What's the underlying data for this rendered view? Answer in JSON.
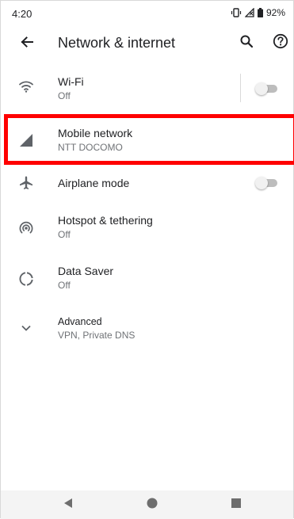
{
  "status_bar": {
    "time": "4:20",
    "battery": "92%"
  },
  "app_bar": {
    "title": "Network & internet",
    "icons": {
      "back": "arrow-back-icon",
      "search": "search-icon",
      "help": "help-icon"
    }
  },
  "settings": {
    "items": [
      {
        "title": "Wi-Fi",
        "summary": "Off",
        "icon": "wifi-icon",
        "toggle": "off"
      },
      {
        "title": "Mobile network",
        "summary": "NTT DOCOMO",
        "icon": "cell-signal-icon"
      },
      {
        "title": "Airplane mode",
        "icon": "airplane-icon",
        "toggle": "off"
      },
      {
        "title": "Hotspot & tethering",
        "summary": "Off",
        "icon": "hotspot-icon"
      },
      {
        "title": "Data Saver",
        "summary": "Off",
        "icon": "data-saver-icon"
      },
      {
        "title": "Advanced",
        "summary": "VPN, Private DNS",
        "icon": "chevron-down-icon"
      }
    ]
  },
  "highlight": {
    "target": "Mobile network",
    "color": "#ff0000"
  },
  "colors": {
    "text_primary": "#202124",
    "text_secondary": "#6f7276",
    "icon": "#5f6368",
    "toggle_track": "#bdbdbd",
    "toggle_thumb": "#f1f1f1",
    "nav_bar": "#f4f4f4"
  },
  "nav_bar": {
    "icons": [
      "nav-back-icon",
      "nav-home-icon",
      "nav-recents-icon"
    ]
  }
}
